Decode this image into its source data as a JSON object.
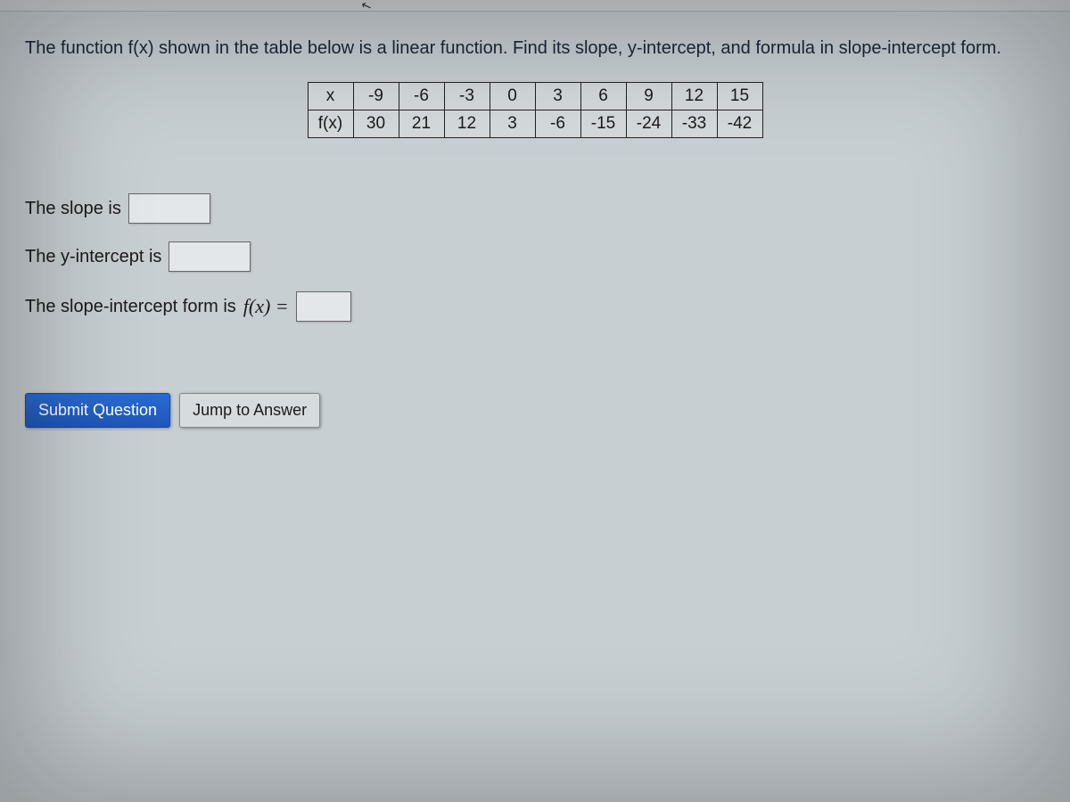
{
  "prompt": "The function f(x) shown in the table below is a linear function. Find its slope, y-intercept, and formula in slope-intercept form.",
  "table": {
    "row_labels": [
      "x",
      "f(x)"
    ],
    "x": [
      "-9",
      "-6",
      "-3",
      "0",
      "3",
      "6",
      "9",
      "12",
      "15"
    ],
    "fx": [
      "30",
      "21",
      "12",
      "3",
      "-6",
      "-15",
      "-24",
      "-33",
      "-42"
    ]
  },
  "answers": {
    "slope_label": "The slope is",
    "yint_label": "The y-intercept is",
    "form_label_pre": "The slope-intercept form is",
    "form_fx": "f(x) =",
    "slope_value": "",
    "yint_value": "",
    "form_value": ""
  },
  "buttons": {
    "submit": "Submit Question",
    "jump": "Jump to Answer"
  }
}
